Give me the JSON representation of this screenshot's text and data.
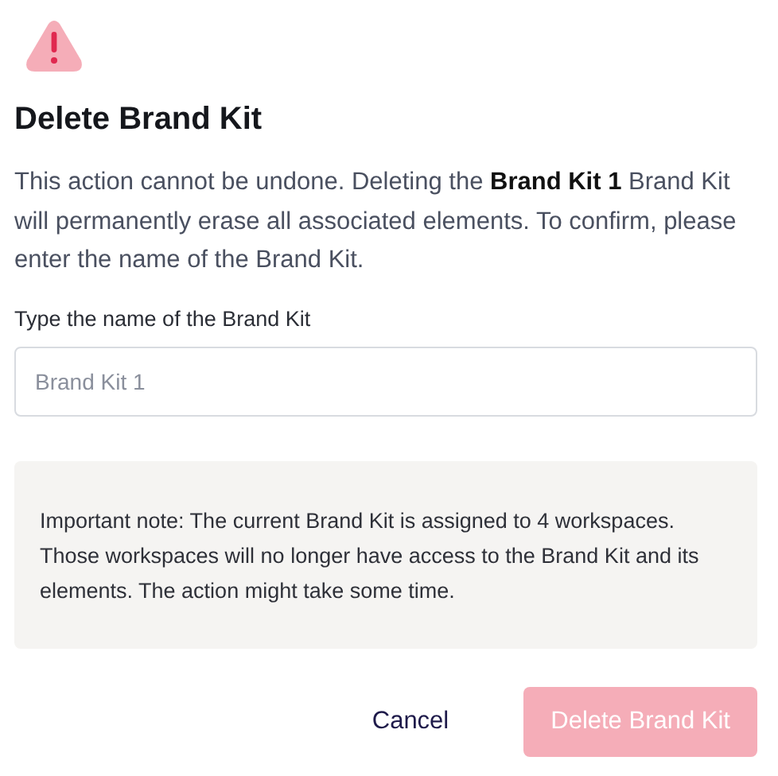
{
  "dialog": {
    "title": "Delete Brand Kit",
    "message": "This action cannot be undone. Deleting the **Brand Kit 1** Brand Kit will permanently erase all associated elements. To confirm, please enter the name of the Brand Kit.",
    "field": {
      "label": "Type the name of the Brand Kit",
      "placeholder": "Brand Kit 1"
    },
    "note": "Important note: The current Brand Kit is assigned to 4 workspaces. Those workspaces will no longer have access to the Brand Kit and its elements. The action might take some time.",
    "buttons": [
      {
        "kind": "secondary",
        "label": "Cancel",
        "disabled": false
      },
      {
        "kind": "danger",
        "label": "Delete Brand Kit",
        "disabled": true
      }
    ]
  }
}
